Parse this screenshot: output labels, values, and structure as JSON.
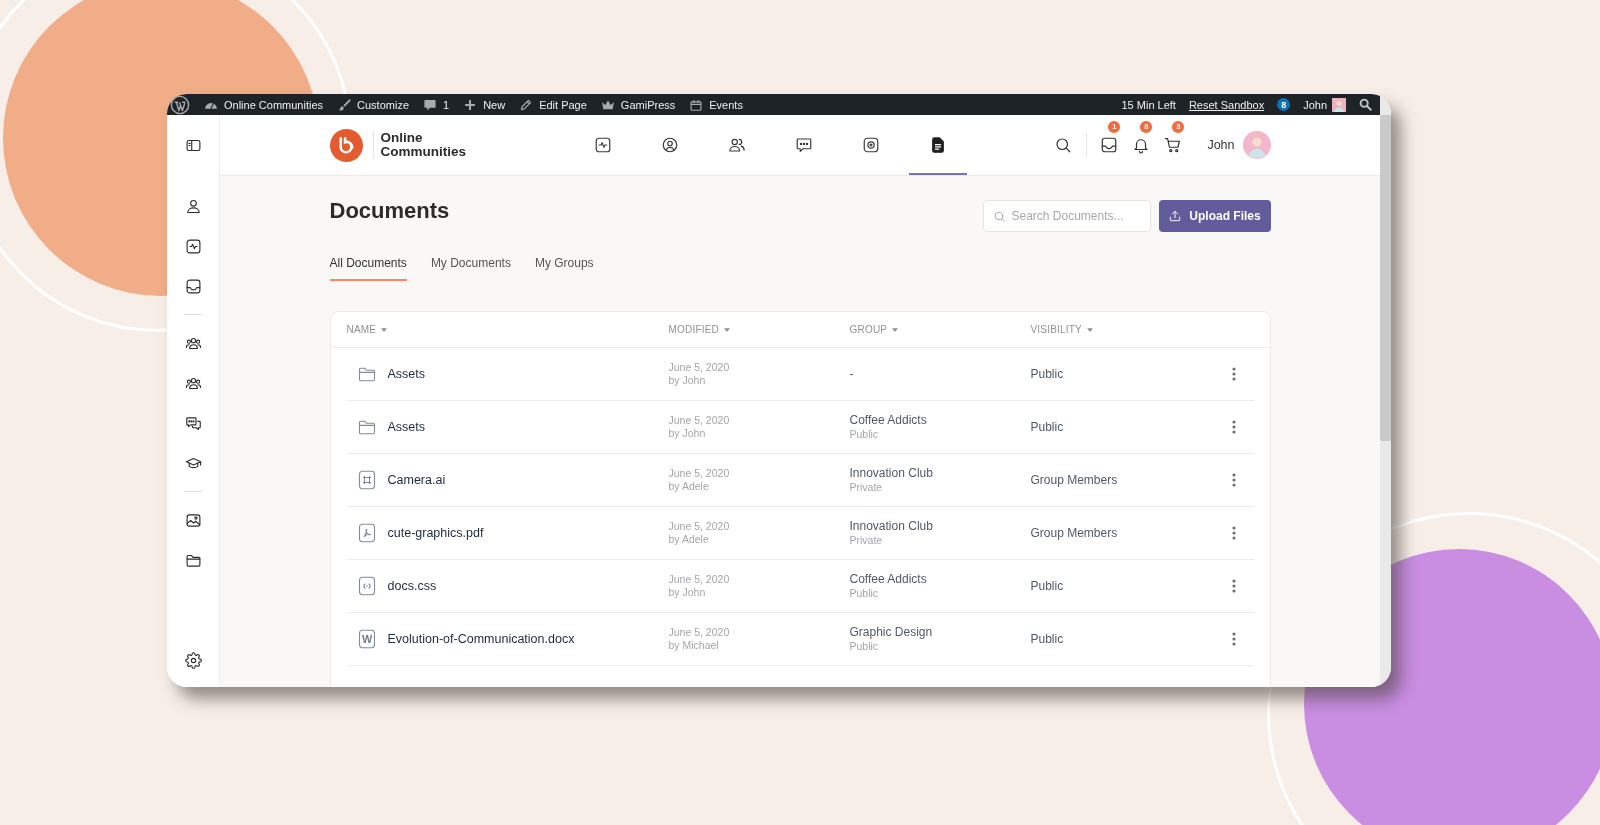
{
  "admin_bar": {
    "items": [
      {
        "kind": "site",
        "label": "Online Communities"
      },
      {
        "kind": "customize",
        "label": "Customize"
      },
      {
        "kind": "comments",
        "label": "1"
      },
      {
        "kind": "new",
        "label": "New"
      },
      {
        "kind": "edit",
        "label": "Edit Page"
      },
      {
        "kind": "gamipress",
        "label": "GamiPress"
      },
      {
        "kind": "events",
        "label": "Events"
      }
    ],
    "timer": "15 Min Left",
    "reset_link": "Reset Sandbox",
    "notification_count": "8",
    "user_name": "John"
  },
  "sidebar": {
    "sections": [
      {
        "items": [
          {
            "kind": "profile"
          },
          {
            "kind": "activity"
          },
          {
            "kind": "inbox"
          }
        ]
      },
      {
        "items": [
          {
            "kind": "groups"
          },
          {
            "kind": "groups"
          },
          {
            "kind": "forums"
          },
          {
            "kind": "courses"
          }
        ]
      },
      {
        "items": [
          {
            "kind": "photos"
          },
          {
            "kind": "documents"
          }
        ]
      }
    ]
  },
  "header": {
    "site_title": "Online Communities",
    "nav": [
      {
        "kind": "activity",
        "selected": false
      },
      {
        "kind": "profile",
        "selected": false
      },
      {
        "kind": "members",
        "selected": false
      },
      {
        "kind": "messages",
        "selected": false
      },
      {
        "kind": "photos",
        "selected": false
      },
      {
        "kind": "documents",
        "selected": true
      }
    ],
    "actions": [
      {
        "kind": "messages",
        "badge": "1"
      },
      {
        "kind": "notifications",
        "badge": "8"
      },
      {
        "kind": "cart",
        "badge": "3"
      }
    ],
    "user_name": "John"
  },
  "page": {
    "title": "Documents",
    "search": {
      "placeholder": "Search Documents..."
    },
    "upload_button": "Upload Files",
    "tabs": [
      {
        "label": "All Documents",
        "selected": true
      },
      {
        "label": "My Documents",
        "selected": false
      },
      {
        "label": "My Groups",
        "selected": false
      }
    ]
  },
  "table": {
    "columns": [
      "NAME",
      "MODIFIED",
      "GROUP",
      "VISIBILITY"
    ],
    "rows": [
      {
        "kind": "folder",
        "name": "Assets",
        "modified": "June 5, 2020",
        "author": "by John",
        "group": "-",
        "visibility": "Public"
      },
      {
        "kind": "folder",
        "name": "Assets",
        "modified": "June 5, 2020",
        "author": "by John",
        "group": "Coffee Addicts",
        "group_privacy": "Public",
        "visibility": "Public"
      },
      {
        "kind": "artboard",
        "name": "Camera.ai",
        "modified": "June 5, 2020",
        "author": "by Adele",
        "group": "Innovation Club",
        "group_privacy": "Private",
        "visibility": "Group Members"
      },
      {
        "kind": "pdf",
        "name": "cute-graphics.pdf",
        "modified": "June 5, 2020",
        "author": "by Adele",
        "group": "Innovation Club",
        "group_privacy": "Private",
        "visibility": "Group Members"
      },
      {
        "kind": "code",
        "name": "docs.css",
        "modified": "June 5, 2020",
        "author": "by John",
        "group": "Coffee Addicts",
        "group_privacy": "Public",
        "visibility": "Public"
      },
      {
        "kind": "word",
        "icon_label": "W",
        "name": "Evolution-of-Communication.docx",
        "modified": "June 5, 2020",
        "author": "by Michael",
        "group": "Graphic Design",
        "group_privacy": "Public",
        "visibility": "Public"
      }
    ]
  }
}
